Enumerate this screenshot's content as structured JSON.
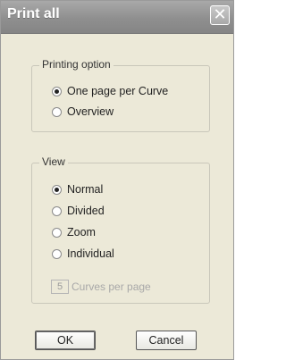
{
  "window": {
    "title": "Print all",
    "close_glyph": "✕"
  },
  "printing_option": {
    "label": "Printing option",
    "options": [
      {
        "label": "One page per Curve",
        "checked": true
      },
      {
        "label": "Overview",
        "checked": false
      }
    ]
  },
  "view": {
    "label": "View",
    "options": [
      {
        "label": "Normal",
        "checked": true
      },
      {
        "label": "Divided",
        "checked": false
      },
      {
        "label": "Zoom",
        "checked": false
      },
      {
        "label": "Individual",
        "checked": false
      }
    ],
    "curves_per_page": {
      "value": "5",
      "label": "Curves per page",
      "enabled": false
    }
  },
  "buttons": {
    "ok": "OK",
    "cancel": "Cancel"
  }
}
